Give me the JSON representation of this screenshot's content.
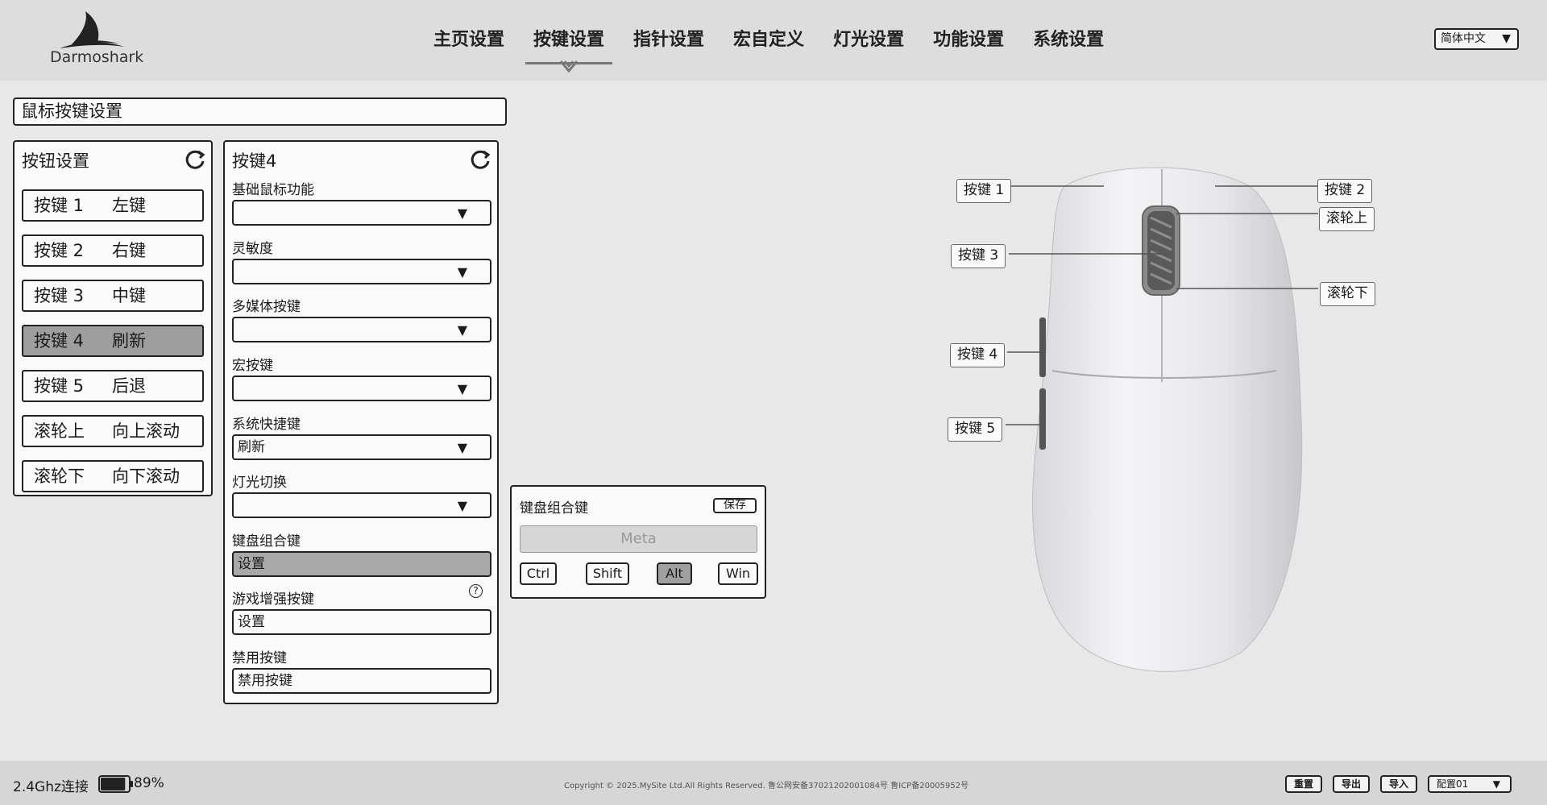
{
  "brand": {
    "logo_text": "Darmoshark"
  },
  "nav": {
    "items": [
      "主页设置",
      "按键设置",
      "指针设置",
      "宏自定义",
      "灯光设置",
      "功能设置",
      "系统设置"
    ],
    "active_index": 1
  },
  "language": {
    "selected": "简体中文"
  },
  "section_title": "鼠标按键设置",
  "button_panel": {
    "title": "按钮设置",
    "items": [
      {
        "key": "按键 1",
        "value": "左键"
      },
      {
        "key": "按键 2",
        "value": "右键"
      },
      {
        "key": "按键 3",
        "value": "中键"
      },
      {
        "key": "按键 4",
        "value": "刷新"
      },
      {
        "key": "按键 5",
        "value": "后退"
      },
      {
        "key": "滚轮上",
        "value": "向上滚动"
      },
      {
        "key": "滚轮下",
        "value": "向下滚动"
      }
    ],
    "active_index": 3
  },
  "config_panel": {
    "title": "按键4",
    "basic_label": "基础鼠标功能",
    "basic_value": "",
    "sensitivity_label": "灵敏度",
    "sensitivity_value": "",
    "media_label": "多媒体按键",
    "media_value": "",
    "macro_label": "宏按键",
    "macro_value": "",
    "shortcut_label": "系统快捷键",
    "shortcut_value": "刷新",
    "light_label": "灯光切换",
    "light_value": "",
    "combo_label": "键盘组合键",
    "combo_button": "设置",
    "game_label": "游戏增强按键",
    "game_button": "设置",
    "disable_label": "禁用按键",
    "disable_button": "禁用按键"
  },
  "combo_panel": {
    "title": "键盘组合键",
    "save": "保存",
    "key_display": "Meta",
    "modifiers": [
      "Ctrl",
      "Shift",
      "Alt",
      "Win"
    ],
    "active_modifier": "Alt"
  },
  "mouse_callouts": {
    "btn1": "按键 1",
    "btn2": "按键 2",
    "btn3": "按键 3",
    "btn4": "按键 4",
    "btn5": "按键 5",
    "wheel_up": "滚轮上",
    "wheel_down": "滚轮下"
  },
  "footer": {
    "connection": "2.4Ghz连接",
    "battery_percent": 89,
    "battery_text": "89%",
    "copyright": "Copyright © 2025.MySite Ltd.All Rights Reserved. 鲁公网安备37021202001084号 鲁ICP备20005952号",
    "reset": "重置",
    "export": "导出",
    "import": "导入",
    "config_selected": "配置01"
  }
}
